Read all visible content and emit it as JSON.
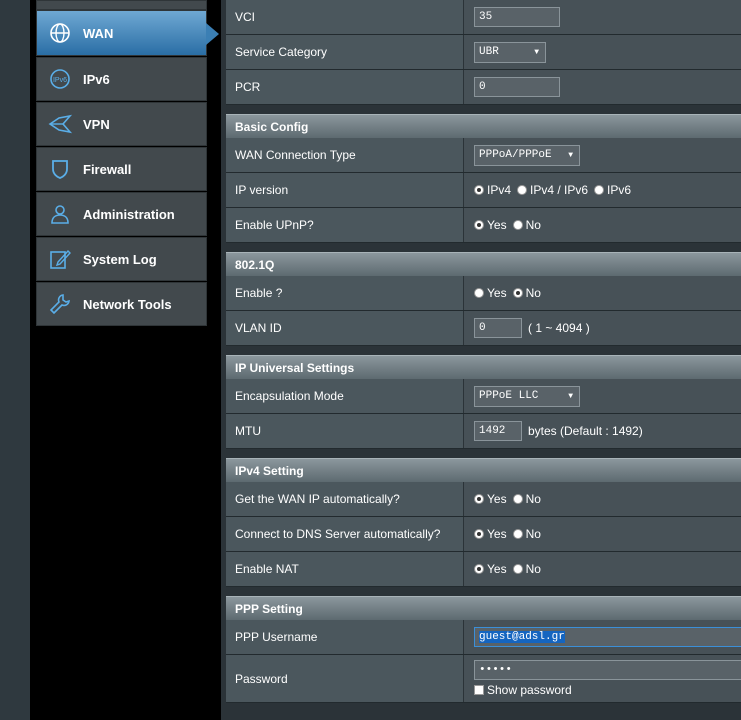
{
  "sidebar": {
    "items": [
      {
        "label": "WAN",
        "icon": "globe-icon",
        "active": true
      },
      {
        "label": "IPv6",
        "icon": "ipv6-icon"
      },
      {
        "label": "VPN",
        "icon": "vpn-icon"
      },
      {
        "label": "Firewall",
        "icon": "shield-icon"
      },
      {
        "label": "Administration",
        "icon": "admin-user-icon"
      },
      {
        "label": "System Log",
        "icon": "edit-icon"
      },
      {
        "label": "Network Tools",
        "icon": "wrench-icon"
      }
    ]
  },
  "top": {
    "vci_label": "VCI",
    "vci_value": "35",
    "service_label": "Service Category",
    "service_value": "UBR",
    "pcr_label": "PCR",
    "pcr_value": "0"
  },
  "basic": {
    "title": "Basic Config",
    "wan_type_label": "WAN Connection Type",
    "wan_type_value": "PPPoA/PPPoE",
    "ip_version_label": "IP version",
    "ip_opt1": "IPv4",
    "ip_opt2": "IPv4 / IPv6",
    "ip_opt3": "IPv6",
    "upnp_label": "Enable UPnP?",
    "yes": "Yes",
    "no": "No"
  },
  "dot1q": {
    "title": "802.1Q",
    "enable_label": "Enable ?",
    "yes": "Yes",
    "no": "No",
    "vlan_label": "VLAN ID",
    "vlan_value": "0",
    "vlan_hint": "( 1 ~ 4094 )"
  },
  "universal": {
    "title": "IP Universal Settings",
    "encap_label": "Encapsulation Mode",
    "encap_value": "PPPoE LLC",
    "mtu_label": "MTU",
    "mtu_value": "1492",
    "mtu_hint": "bytes (Default : 1492)"
  },
  "ipv4": {
    "title": "IPv4 Setting",
    "auto_ip_label": "Get the WAN IP automatically?",
    "dns_label": "Connect to DNS Server automatically?",
    "nat_label": "Enable NAT",
    "yes": "Yes",
    "no": "No"
  },
  "ppp": {
    "title": "PPP Setting",
    "user_label": "PPP Username",
    "user_value": "guest@adsl.gr",
    "pass_label": "Password",
    "pass_value": "•••••",
    "show_label": "Show password"
  }
}
